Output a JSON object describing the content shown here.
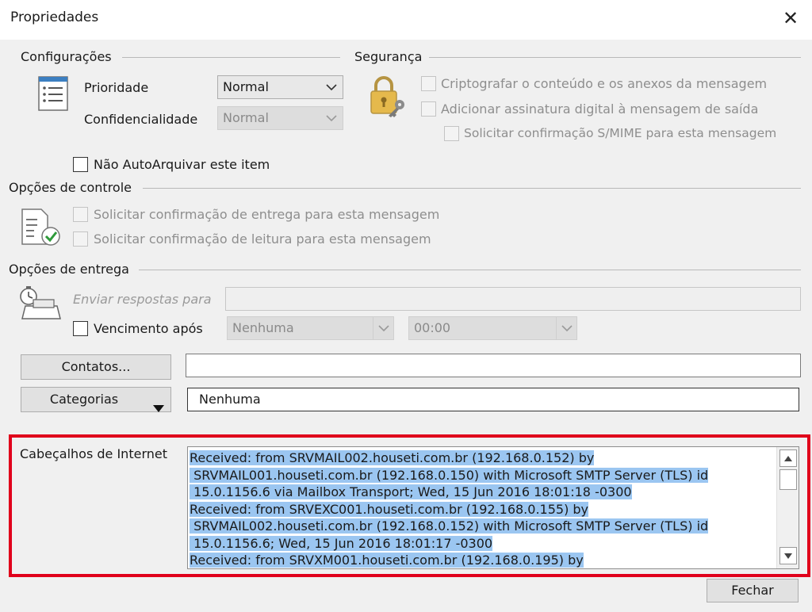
{
  "window": {
    "title": "Propriedades"
  },
  "settings": {
    "heading": "Configurações",
    "priority": {
      "label": "Prioridade",
      "value": "Normal"
    },
    "confidentiality": {
      "label": "Confidencialidade",
      "value": "Normal"
    },
    "no_autoarchive": "Não AutoArquivar este item"
  },
  "security": {
    "heading": "Segurança",
    "encrypt": "Criptografar o conteúdo e os anexos da mensagem",
    "digital_signature": "Adicionar assinatura digital à mensagem de saída",
    "smime_receipt": "Solicitar confirmação S/MIME para esta mensagem"
  },
  "tracking": {
    "heading": "Opções de controle",
    "delivery_receipt": "Solicitar confirmação de entrega para esta mensagem",
    "read_receipt": "Solicitar confirmação de leitura para esta mensagem"
  },
  "delivery": {
    "heading": "Opções de entrega",
    "reply_to_label": "Enviar respostas para",
    "reply_to_value": "",
    "expires_label": "Vencimento após",
    "expires_date": "Nenhuma",
    "expires_time": "00:00"
  },
  "contacts": {
    "button": "Contatos...",
    "value": ""
  },
  "categories": {
    "button": "Categorias",
    "value": "Nenhuma"
  },
  "internet_headers": {
    "label": "Cabeçalhos de Internet",
    "lines": [
      "Received: from SRVMAIL002.houseti.com.br (192.168.0.152) by",
      " SRVMAIL001.houseti.com.br (192.168.0.150) with Microsoft SMTP Server (TLS) id",
      " 15.0.1156.6 via Mailbox Transport; Wed, 15 Jun 2016 18:01:18 -0300",
      "Received: from SRVEXC001.houseti.com.br (192.168.0.155) by",
      " SRVMAIL002.houseti.com.br (192.168.0.152) with Microsoft SMTP Server (TLS) id",
      " 15.0.1156.6; Wed, 15 Jun 2016 18:01:17 -0300",
      "Received: from SRVXM001.houseti.com.br (192.168.0.195) by"
    ]
  },
  "close_button": "Fechar"
}
